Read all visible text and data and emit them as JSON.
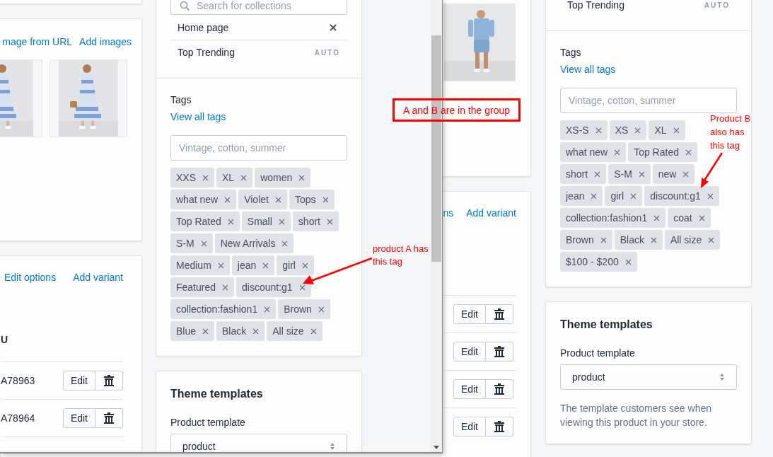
{
  "back_window": {
    "image_card": {
      "images": [
        {
          "kind": "picture"
        }
      ]
    },
    "variants_card": {
      "links": [
        "ns",
        "Add variant"
      ],
      "rows": [
        {
          "edit": "Edit"
        },
        {
          "edit": "Edit"
        },
        {
          "edit": "Edit"
        },
        {
          "edit": "Edit"
        }
      ]
    },
    "collections": {
      "items": [
        {
          "name": "Top Trending",
          "kind": "auto",
          "badge": "AUTO"
        }
      ]
    },
    "tags": {
      "title": "Tags",
      "link": "View all tags",
      "placeholder": "Vintage, cotton, summer",
      "rows": [
        [
          "XS-S",
          "XS",
          "XL"
        ],
        [
          "what new",
          "Top Rated"
        ],
        [
          "short",
          "S-M",
          "new"
        ],
        [
          "jean",
          "girl",
          "discount:g1"
        ],
        [
          "collection:fashion1",
          "coat"
        ],
        [
          "Brown",
          "Black",
          "All size"
        ],
        [
          "$100 - $200"
        ]
      ]
    },
    "theme": {
      "title": "Theme templates",
      "label": "Product template",
      "value": "product",
      "help": "The template customers see when viewing this product in your store."
    }
  },
  "front_window": {
    "images_card": {
      "links": [
        "mage from URL",
        "Add images"
      ],
      "images": [
        {
          "kind": "picture"
        },
        {
          "kind": "picture"
        }
      ]
    },
    "variants_card": {
      "links": [
        "Edit options",
        "Add variant"
      ],
      "column": "U",
      "rows": [
        {
          "sku": "A78963",
          "edit": "Edit"
        },
        {
          "sku": "A78964",
          "edit": "Edit"
        }
      ]
    },
    "collections": {
      "search_placeholder": "Search for collections",
      "items": [
        {
          "name": "Home page",
          "kind": "manual"
        },
        {
          "name": "Top Trending",
          "kind": "auto",
          "badge": "AUTO"
        }
      ]
    },
    "tags": {
      "title": "Tags",
      "link": "View all tags",
      "placeholder": "Vintage, cotton, summer",
      "rows": [
        [
          "XXS",
          "XL",
          "women"
        ],
        [
          "what new",
          "Violet",
          "Tops"
        ],
        [
          "Top Rated",
          "Small",
          "short"
        ],
        [
          "S-M",
          "New Arrivals"
        ],
        [
          "Medium",
          "jean",
          "girl"
        ],
        [
          "Featured",
          "discount:g1"
        ],
        [
          "collection:fashion1",
          "Brown"
        ],
        [
          "Blue",
          "Black",
          "All size"
        ]
      ]
    },
    "theme": {
      "title": "Theme templates",
      "label": "Product template",
      "value": "product"
    }
  },
  "annotations": {
    "group_note": "A and B are in the group",
    "note_a": "product A has this tag",
    "note_b": "Product B also has this tag"
  }
}
